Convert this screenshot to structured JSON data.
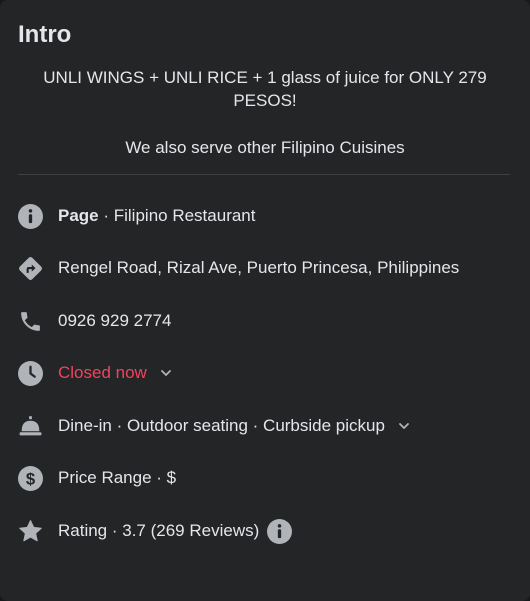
{
  "intro": {
    "title": "Intro",
    "bio_line1": "UNLI WINGS + UNLI RICE + 1 glass of juice for ONLY 279 PESOS!",
    "bio_line2": "We also serve other Filipino Cuisines"
  },
  "details": {
    "page_label": "Page",
    "page_category": " · Filipino Restaurant",
    "address": "Rengel Road, Rizal Ave, Puerto Princesa, Philippines",
    "phone": "0926 929 2774",
    "hours_status": "Closed now",
    "services": "Dine-in · Outdoor seating · Curbside pickup",
    "price_range": "Price Range · $",
    "rating": "Rating · 3.7 (269 Reviews)"
  },
  "colors": {
    "background": "#242526",
    "text": "#e4e6eb",
    "icon": "#b0b3b8",
    "closed": "#f3425f"
  },
  "icons": [
    "info-icon",
    "directions-icon",
    "phone-icon",
    "clock-icon",
    "service-bell-icon",
    "dollar-icon",
    "star-icon",
    "chevron-down-icon"
  ]
}
